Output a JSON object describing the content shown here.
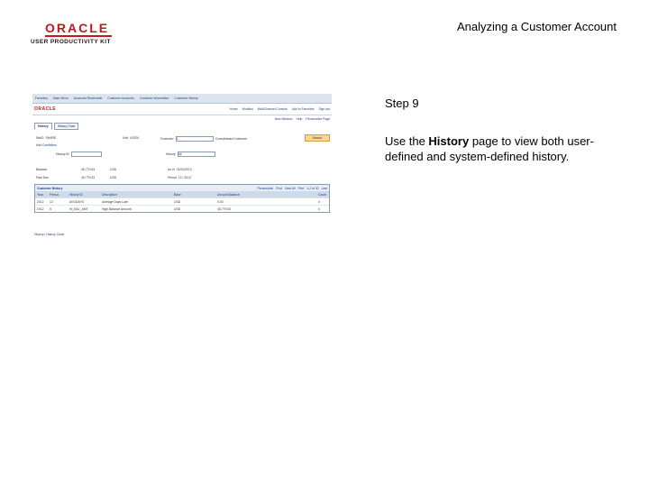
{
  "logo": {
    "oracle": "ORACLE",
    "kit": "USER PRODUCTIVITY KIT"
  },
  "document_title": "Analyzing a Customer Account",
  "step": {
    "label": "Step 9"
  },
  "description": {
    "pre": "Use the ",
    "bold": "History",
    "post": " page to view both user-defined and system-defined history."
  },
  "screenshot": {
    "topnav": [
      "Favorites",
      "Main Menu",
      "Accounts Receivable",
      "Customer Accounts",
      "Customer Information",
      "Customer History"
    ],
    "brand": "ORACLE",
    "brand_links": [
      "Home",
      "Worklist",
      "MultiChannel Console",
      "Add to Favorites",
      "Sign out"
    ],
    "page_links": [
      "New Window",
      "Help",
      "Personalize Page"
    ],
    "tabs": [
      "History",
      "History Chart"
    ],
    "fields": {
      "setid_label": "SetID",
      "setid_value": "SHARE",
      "unit_label": "Unit",
      "unit_value": "US001",
      "customer_label": "Customer",
      "customer_value": "1",
      "customer_name": "Consolidated Customer",
      "search_button": "Search",
      "add_conditions": "Add Conditions",
      "history_id_label": "History ID",
      "history_label": "History",
      "history_value": "All",
      "balance_label": "Balance",
      "balance_amount": "45,779.63",
      "balance_currency": "USD",
      "asof_label": "As of",
      "asof_date": "01/01/2012",
      "pastdue_label": "Past Due",
      "pastdue_amount": "45,779.63",
      "pastdue_currency": "USD",
      "period_label": "Period",
      "period_value": "12 / 2012"
    },
    "grid": {
      "title": "Customer History",
      "nav": [
        "Personalize",
        "Find",
        "View All",
        "First",
        "1-2 of 30",
        "Last"
      ],
      "columns": [
        "Year",
        "Period",
        "History ID",
        "Description",
        "Base",
        "Amount Balance",
        "",
        "Count"
      ],
      "rows": [
        [
          "2012",
          "12",
          "AVGDAYS",
          "Average Days Late",
          "USD",
          "0.00",
          "",
          "0"
        ],
        [
          "2012",
          "5",
          "HI_BAL_AMT",
          "High Balance Amount",
          "USD",
          "45,779.63",
          "",
          "0"
        ]
      ]
    },
    "footer_links": "History | History Chart"
  }
}
